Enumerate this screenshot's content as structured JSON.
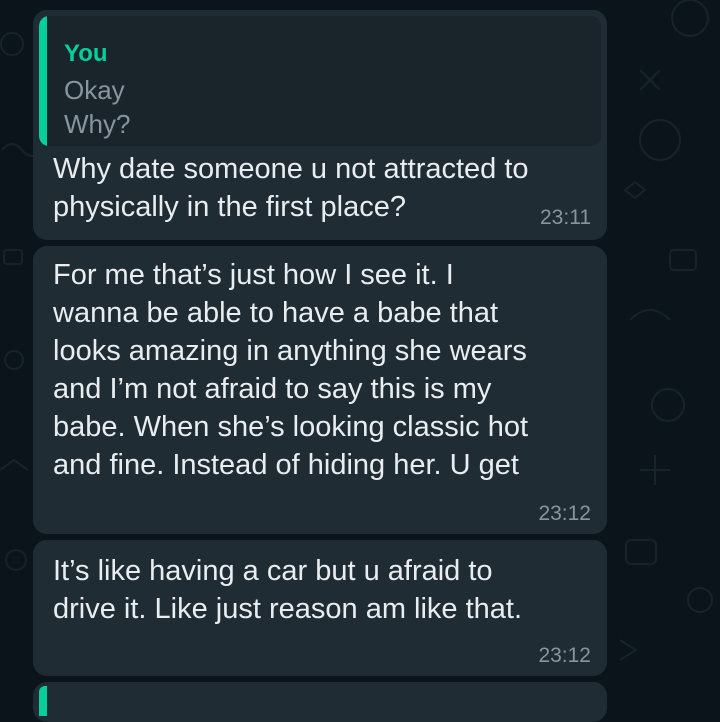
{
  "messages": [
    {
      "quote": {
        "author": "You",
        "lines": [
          "Okay",
          "Why?"
        ]
      },
      "text": "Why date someone u not attracted to\nphysically in the first place?",
      "time": "23:11"
    },
    {
      "text": "For me that’s just how I see it. I\nwanna be able to have a babe that\nlooks amazing in anything she wears\nand I’m not afraid to say this is my\nbabe. When she’s looking classic hot\nand fine. Instead of hiding her. U get",
      "time": "23:12"
    },
    {
      "text": "It’s like having a car but u afraid to\ndrive it. Like just reason am like that.",
      "time": "23:12"
    }
  ],
  "colors": {
    "background": "#0b141a",
    "bubble": "#1f2c33",
    "quote_accent": "#06cf9c",
    "text": "#e9edef",
    "meta": "#8696a0"
  }
}
